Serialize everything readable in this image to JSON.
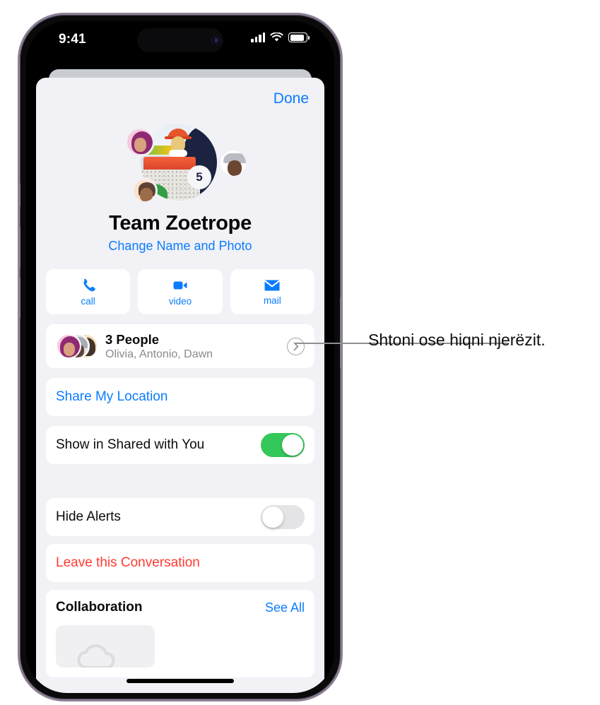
{
  "status_bar": {
    "time": "9:41",
    "cellular_icon": "cellular-signal-icon",
    "wifi_icon": "wifi-icon",
    "battery_icon": "battery-icon"
  },
  "sheet": {
    "done_label": "Done",
    "group_title": "Team Zoetrope",
    "change_name_photo_label": "Change Name and Photo",
    "avatar": {
      "ball_number": "5"
    },
    "action_buttons": [
      {
        "label": "call",
        "icon": "phone-icon"
      },
      {
        "label": "video",
        "icon": "video-camera-icon"
      },
      {
        "label": "mail",
        "icon": "envelope-icon"
      }
    ],
    "people_row": {
      "count_label": "3 People",
      "names_label": "Olivia, Antonio, Dawn",
      "chevron_icon": "chevron-right-icon"
    },
    "share_location_label": "Share My Location",
    "show_in_shared_with_you": {
      "label": "Show in Shared with You",
      "state": "on"
    },
    "hide_alerts": {
      "label": "Hide Alerts",
      "state": "off"
    },
    "leave_conversation_label": "Leave this Conversation",
    "collaboration": {
      "title": "Collaboration",
      "see_all_label": "See All"
    }
  },
  "callout": {
    "text": "Shtoni ose hiqni njerëzit."
  },
  "colors": {
    "accent_blue": "#0a7cff",
    "toggle_green": "#34c759",
    "destructive_red": "#ff3b30",
    "sheet_background": "#f1f1f6",
    "card_background": "#ffffff",
    "secondary_text": "#8a8a8e"
  }
}
